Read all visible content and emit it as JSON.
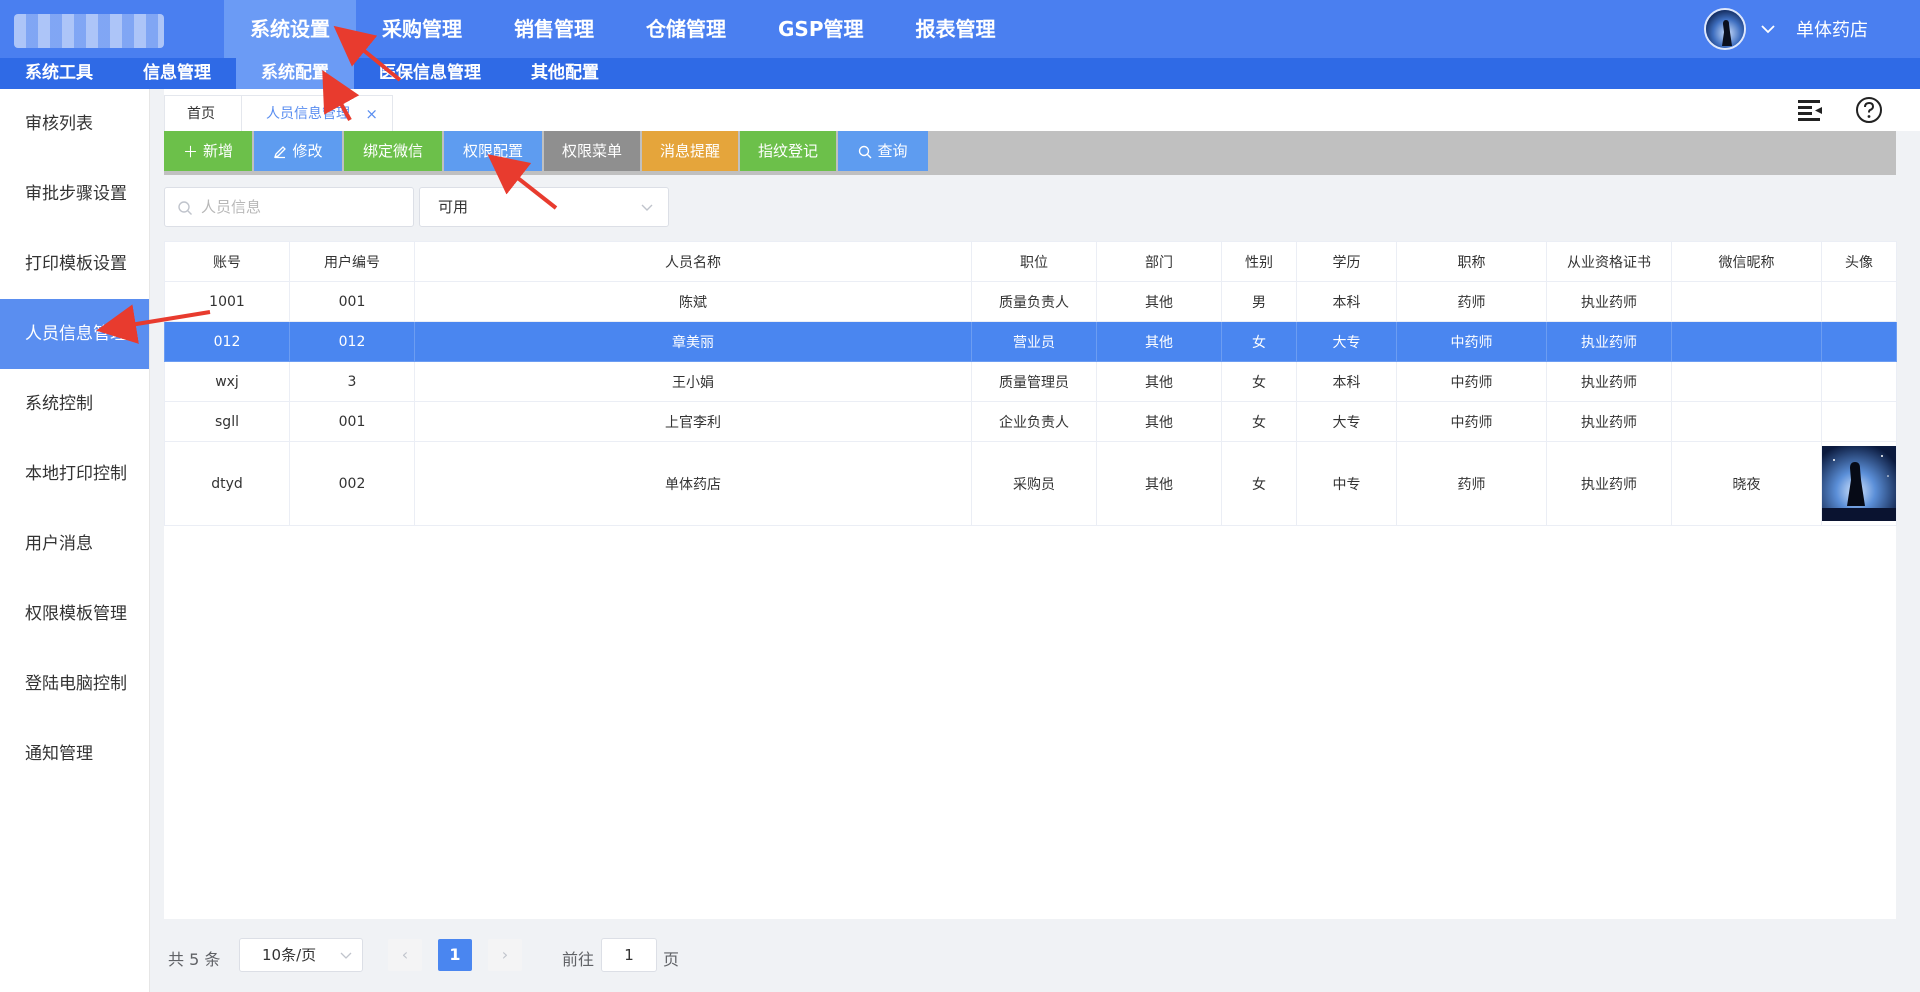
{
  "header": {
    "main_nav": [
      "系统设置",
      "采购管理",
      "销售管理",
      "仓储管理",
      "GSP管理",
      "报表管理"
    ],
    "user_name": "单体药店"
  },
  "sub_nav": [
    "系统工具",
    "信息管理",
    "系统配置",
    "医保信息管理",
    "其他配置"
  ],
  "sidebar": [
    "审核列表",
    "审批步骤设置",
    "打印模板设置",
    "人员信息管理",
    "系统控制",
    "本地打印控制",
    "用户消息",
    "权限模板管理",
    "登陆电脑控制",
    "通知管理"
  ],
  "tabs": {
    "home": "首页",
    "current": "人员信息管理",
    "close": "×"
  },
  "toolbar": {
    "add": "新增",
    "edit": "修改",
    "bind_wechat": "绑定微信",
    "perm_config": "权限配置",
    "perm_menu": "权限菜单",
    "msg_remind": "消息提醒",
    "fingerprint": "指纹登记",
    "query": "查询"
  },
  "filters": {
    "search_placeholder": "人员信息",
    "status_value": "可用"
  },
  "table": {
    "headers": [
      "账号",
      "用户编号",
      "人员名称",
      "职位",
      "部门",
      "性别",
      "学历",
      "职称",
      "从业资格证书",
      "微信昵称",
      "头像"
    ],
    "rows": [
      [
        "1001",
        "001",
        "陈斌",
        "质量负责人",
        "其他",
        "男",
        "本科",
        "药师",
        "执业药师",
        ""
      ],
      [
        "012",
        "012",
        "章美丽",
        "营业员",
        "其他",
        "女",
        "大专",
        "中药师",
        "执业药师",
        ""
      ],
      [
        "wxj",
        "3",
        "王小娟",
        "质量管理员",
        "其他",
        "女",
        "本科",
        "中药师",
        "执业药师",
        ""
      ],
      [
        "sgll",
        "001",
        "上官李利",
        "企业负责人",
        "其他",
        "女",
        "大专",
        "中药师",
        "执业药师",
        ""
      ],
      [
        "dtyd",
        "002",
        "单体药店",
        "采购员",
        "其他",
        "女",
        "中专",
        "药师",
        "执业药师",
        "晓夜"
      ]
    ]
  },
  "pagination": {
    "total": "共 5 条",
    "page_size": "10条/页",
    "prev": "‹",
    "next": "›",
    "current": "1",
    "goto_prefix": "前往",
    "goto_value": "1",
    "goto_suffix": "页"
  },
  "colors": {
    "topbar": "#4a7ff0",
    "subbar": "#2f6ae6",
    "active_nav": "#6b9bf5",
    "btn_green": "#6cc04a",
    "btn_blue": "#5e9cf0",
    "btn_gray": "#8f8f8f",
    "btn_orange": "#e5a53b",
    "selected_row": "#4a86f0",
    "annotation_red": "#e83b2e"
  }
}
